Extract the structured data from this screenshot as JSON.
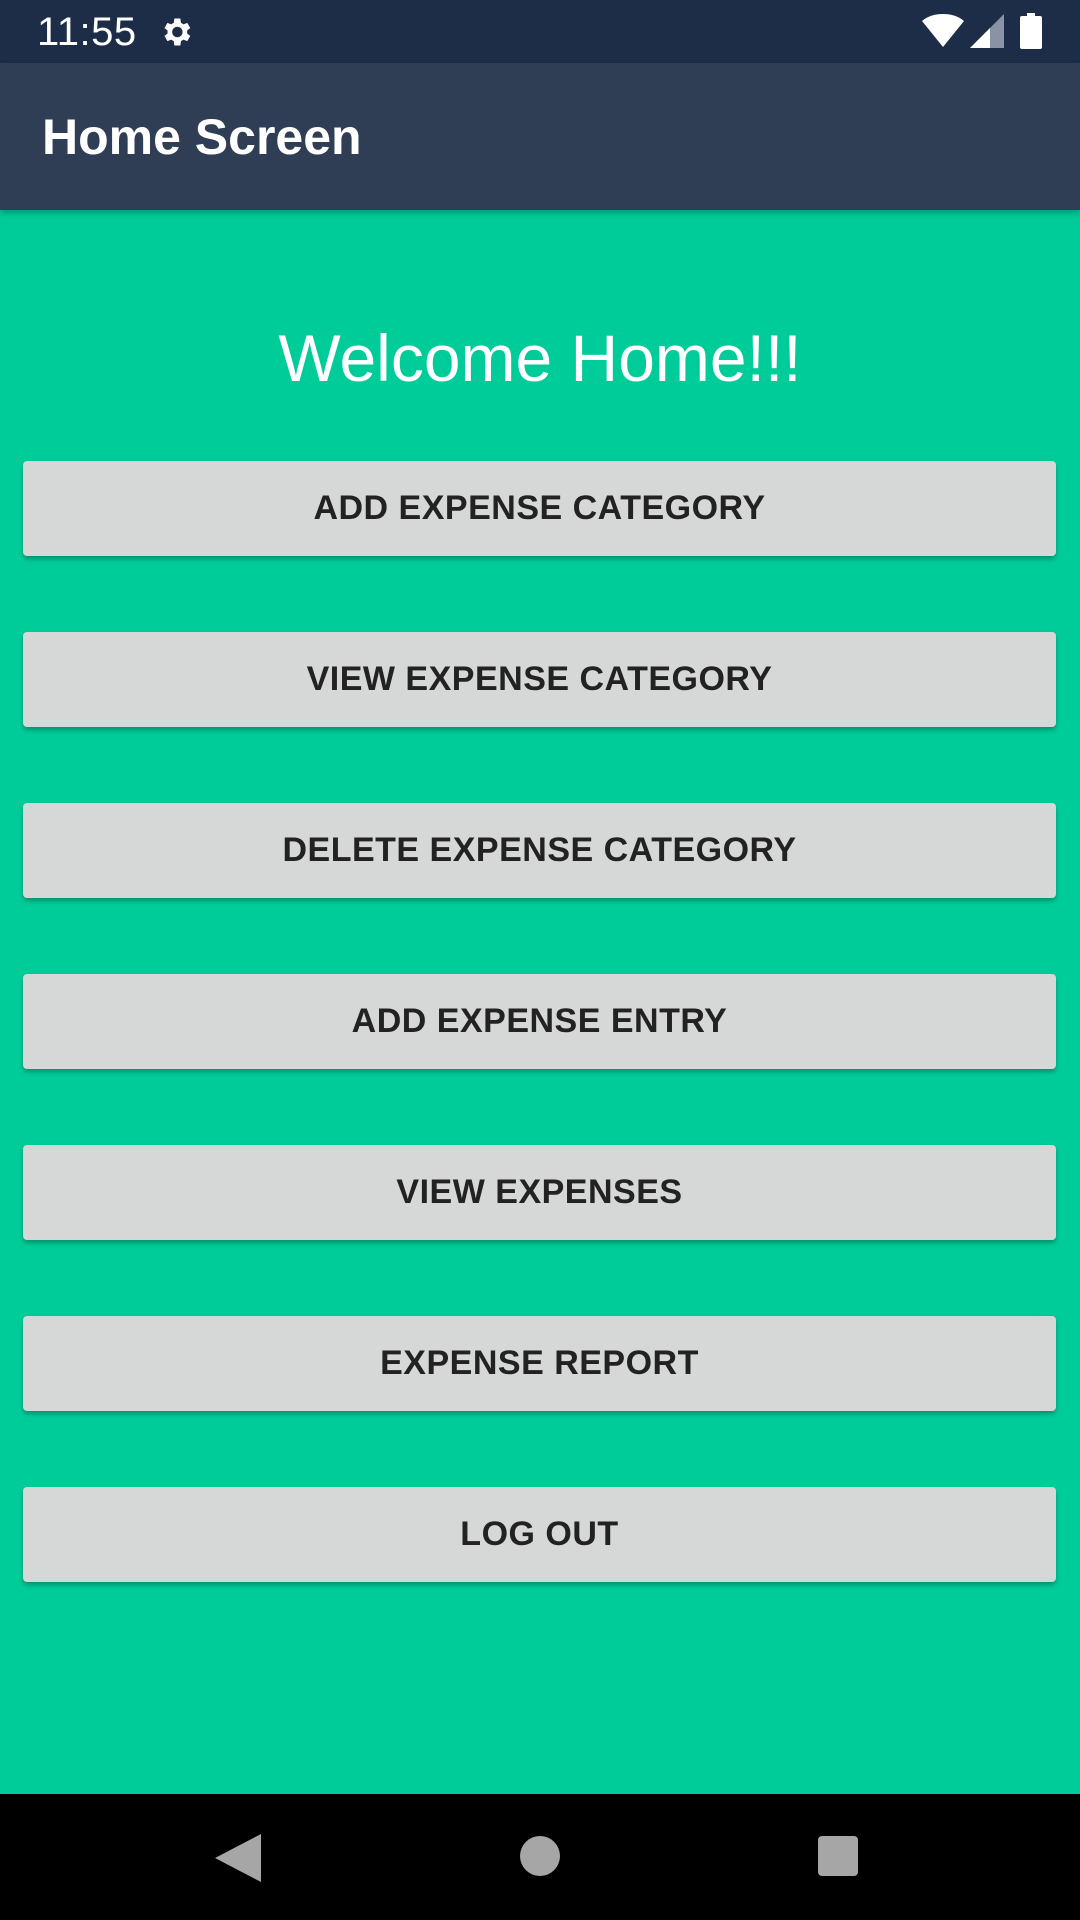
{
  "status_bar": {
    "time": "11:55",
    "icons": [
      "settings-gear-icon",
      "wifi-icon",
      "cell-signal-icon",
      "battery-icon"
    ]
  },
  "app_bar": {
    "title": "Home Screen"
  },
  "main": {
    "welcome_text": "Welcome Home!!!",
    "buttons": [
      "ADD EXPENSE CATEGORY",
      "VIEW EXPENSE CATEGORY",
      "DELETE EXPENSE CATEGORY",
      "ADD EXPENSE ENTRY",
      "VIEW EXPENSES",
      "EXPENSE REPORT",
      "LOG OUT"
    ]
  },
  "nav_bar": {
    "icons": [
      "back-icon",
      "home-icon",
      "recents-icon"
    ]
  },
  "colors": {
    "background": "#00cc99",
    "status_bar": "#1e2d47",
    "app_bar": "#2f3e55",
    "button": "#d6d7d7",
    "button_text": "#222222",
    "nav_bar": "#000000"
  }
}
